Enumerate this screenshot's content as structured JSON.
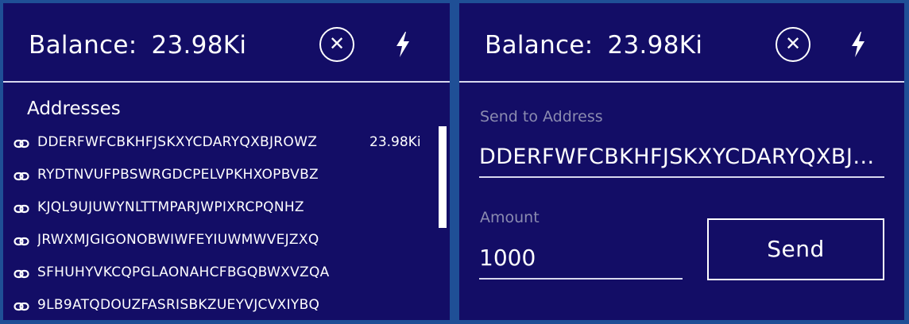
{
  "wallet_panel": {
    "balance_label": "Balance:",
    "balance_value": "23.98Ki",
    "close_icon": "close-circle-icon",
    "bolt_icon": "lightning-bolt-icon",
    "addresses_title": "Addresses",
    "addresses": [
      {
        "address": "DDERFWFCBKHFJSKXYCDARYQXBJROWZ",
        "balance": "23.98Ki"
      },
      {
        "address": "RYDTNVUFPBSWRGDCPELVPKHXOPBVBZ",
        "balance": ""
      },
      {
        "address": "KJQL9UJUWYNLTTMPARJWPIXRCPQNHZ",
        "balance": ""
      },
      {
        "address": "JRWXMJGIGONOBWIWFEYIUWMWVEJZXQ",
        "balance": ""
      },
      {
        "address": "SFHUHYVKCQPGLAONAHCFBGQBWXVZQA",
        "balance": ""
      },
      {
        "address": "9LB9ATQDOUZFASRISBKZUEYVJCVXIYBQ",
        "balance": ""
      }
    ]
  },
  "send_panel": {
    "balance_label": "Balance:",
    "balance_value": "23.98Ki",
    "close_icon": "close-circle-icon",
    "bolt_icon": "lightning-bolt-icon",
    "send_to_label": "Send to Address",
    "send_to_value": "DDERFWFCBKHFJSKXYCDARYQXBJROWZ",
    "amount_label": "Amount",
    "amount_value": "1000",
    "send_button_label": "Send"
  },
  "colors": {
    "panel_background": "#130d66",
    "outer_background": "#1f4f96",
    "divider": "#d7d8ee",
    "muted_label": "#8b8bb0",
    "text": "#ffffff"
  }
}
